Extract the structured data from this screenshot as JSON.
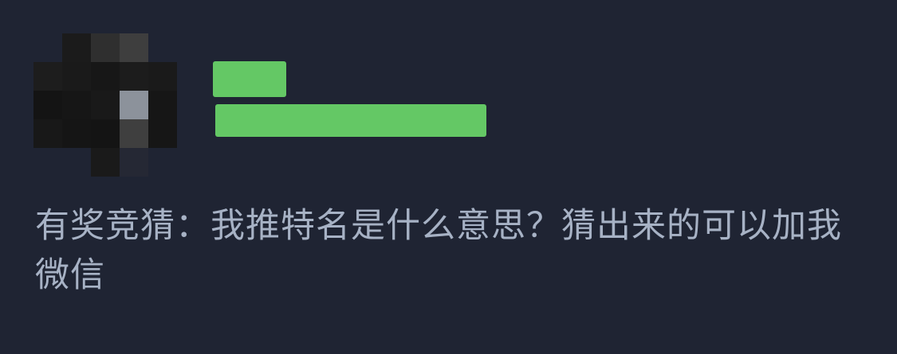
{
  "post": {
    "text": "有奖竞猜：我推特名是什么意思？猜出来的可以加我微信"
  },
  "colors": {
    "background": "#1f2433",
    "redaction": "#64c865",
    "text": "#a7b2c5"
  },
  "avatar": {
    "description": "pixelated-avatar",
    "pixels": [
      [
        null,
        "#1b1b1b",
        "#2f2f2f",
        "#3e3e3e",
        null
      ],
      [
        "#1d1d1d",
        "#1a1a1a",
        "#171717",
        "#1c1c1c",
        "#1a1a1a"
      ],
      [
        "#141414",
        "#161616",
        "#191919",
        "#8c929b",
        "#161616"
      ],
      [
        "#181818",
        "#151515",
        "#141414",
        "#3f3f3f",
        "#161616"
      ],
      [
        null,
        null,
        "#1a1a1a",
        "#252834",
        null
      ]
    ]
  }
}
